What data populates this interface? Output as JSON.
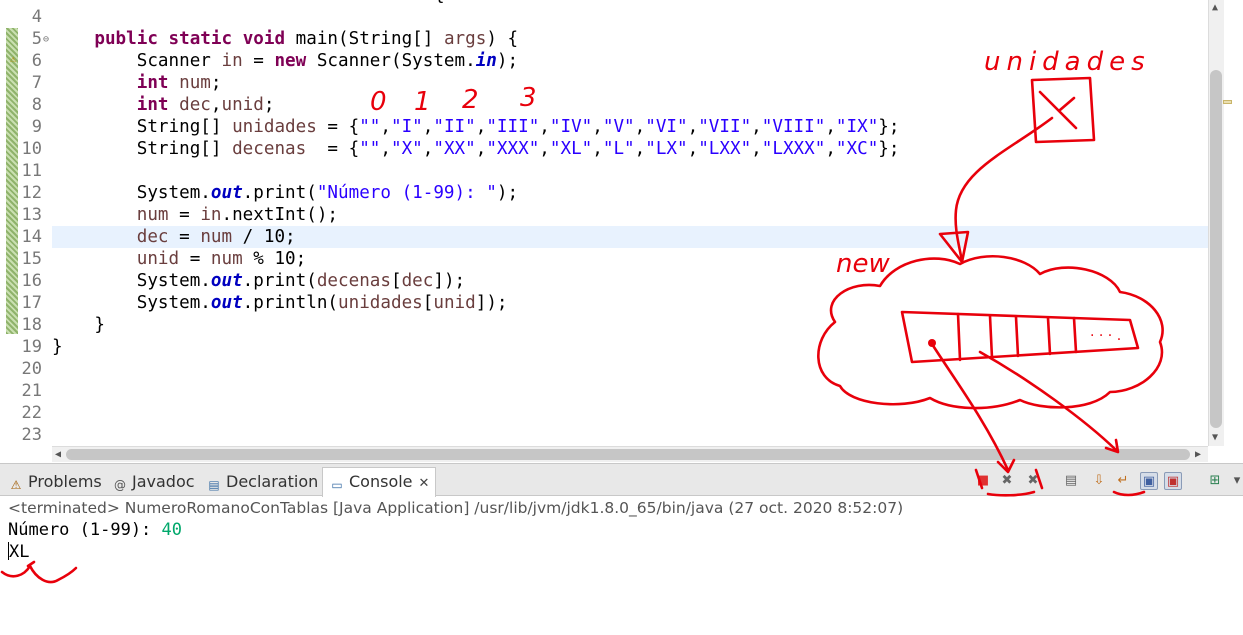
{
  "editor": {
    "line_numbers": [
      "4",
      "5",
      "6",
      "7",
      "8",
      "9",
      "10",
      "11",
      "12",
      "13",
      "14",
      "15",
      "16",
      "17",
      "18",
      "19",
      "20",
      "21",
      "22",
      "23"
    ],
    "fold_marker": "⊖",
    "top_fragment": "{",
    "current_line": "14",
    "lines": [
      {
        "n": "4",
        "tokens": []
      },
      {
        "n": "5",
        "tokens": [
          [
            "    ",
            ""
          ],
          [
            "public",
            "kw"
          ],
          [
            " ",
            ""
          ],
          [
            "static",
            "kw"
          ],
          [
            " ",
            ""
          ],
          [
            "void",
            "kw"
          ],
          [
            " main(String[] ",
            ""
          ],
          [
            "args",
            "var"
          ],
          [
            ") {",
            ""
          ]
        ]
      },
      {
        "n": "6",
        "tokens": [
          [
            "        Scanner ",
            ""
          ],
          [
            "in",
            "var"
          ],
          [
            " = ",
            ""
          ],
          [
            "new",
            "kw"
          ],
          [
            " Scanner(System.",
            ""
          ],
          [
            "in",
            "fld"
          ],
          [
            ");",
            ""
          ]
        ]
      },
      {
        "n": "7",
        "tokens": [
          [
            "        ",
            ""
          ],
          [
            "int",
            "kw"
          ],
          [
            " ",
            ""
          ],
          [
            "num",
            "var"
          ],
          [
            ";",
            ""
          ]
        ]
      },
      {
        "n": "8",
        "tokens": [
          [
            "        ",
            ""
          ],
          [
            "int",
            "kw"
          ],
          [
            " ",
            ""
          ],
          [
            "dec",
            "var"
          ],
          [
            ",",
            ""
          ],
          [
            "unid",
            "var"
          ],
          [
            ";",
            ""
          ]
        ]
      },
      {
        "n": "9",
        "tokens": [
          [
            "        String[] ",
            ""
          ],
          [
            "unidades",
            "var"
          ],
          [
            " = {",
            ""
          ],
          [
            "\"\"",
            "str"
          ],
          [
            ",",
            ""
          ],
          [
            "\"I\"",
            "str"
          ],
          [
            ",",
            ""
          ],
          [
            "\"II\"",
            "str"
          ],
          [
            ",",
            ""
          ],
          [
            "\"III\"",
            "str"
          ],
          [
            ",",
            ""
          ],
          [
            "\"IV\"",
            "str"
          ],
          [
            ",",
            ""
          ],
          [
            "\"V\"",
            "str"
          ],
          [
            ",",
            ""
          ],
          [
            "\"VI\"",
            "str"
          ],
          [
            ",",
            ""
          ],
          [
            "\"VII\"",
            "str"
          ],
          [
            ",",
            ""
          ],
          [
            "\"VIII\"",
            "str"
          ],
          [
            ",",
            ""
          ],
          [
            "\"IX\"",
            "str"
          ],
          [
            "};",
            ""
          ]
        ]
      },
      {
        "n": "10",
        "tokens": [
          [
            "        String[] ",
            ""
          ],
          [
            "decenas",
            "var"
          ],
          [
            "  = {",
            ""
          ],
          [
            "\"\"",
            "str"
          ],
          [
            ",",
            ""
          ],
          [
            "\"X\"",
            "str"
          ],
          [
            ",",
            ""
          ],
          [
            "\"XX\"",
            "str"
          ],
          [
            ",",
            ""
          ],
          [
            "\"XXX\"",
            "str"
          ],
          [
            ",",
            ""
          ],
          [
            "\"XL\"",
            "str"
          ],
          [
            ",",
            ""
          ],
          [
            "\"L\"",
            "str"
          ],
          [
            ",",
            ""
          ],
          [
            "\"LX\"",
            "str"
          ],
          [
            ",",
            ""
          ],
          [
            "\"LXX\"",
            "str"
          ],
          [
            ",",
            ""
          ],
          [
            "\"LXXX\"",
            "str"
          ],
          [
            ",",
            ""
          ],
          [
            "\"XC\"",
            "str"
          ],
          [
            "};",
            ""
          ]
        ]
      },
      {
        "n": "11",
        "tokens": []
      },
      {
        "n": "12",
        "tokens": [
          [
            "        System.",
            ""
          ],
          [
            "out",
            "fld"
          ],
          [
            ".print(",
            ""
          ],
          [
            "\"Número (1-99): \"",
            "str"
          ],
          [
            ");",
            ""
          ]
        ]
      },
      {
        "n": "13",
        "tokens": [
          [
            "        ",
            ""
          ],
          [
            "num",
            "var"
          ],
          [
            " = ",
            ""
          ],
          [
            "in",
            "var"
          ],
          [
            ".nextInt();",
            ""
          ]
        ]
      },
      {
        "n": "14",
        "tokens": [
          [
            "        ",
            ""
          ],
          [
            "dec",
            "var"
          ],
          [
            " = ",
            ""
          ],
          [
            "num",
            "var"
          ],
          [
            " / 10;",
            ""
          ]
        ]
      },
      {
        "n": "15",
        "tokens": [
          [
            "        ",
            ""
          ],
          [
            "unid",
            "var"
          ],
          [
            " = ",
            ""
          ],
          [
            "num",
            "var"
          ],
          [
            " % 10;",
            ""
          ]
        ]
      },
      {
        "n": "16",
        "tokens": [
          [
            "        System.",
            ""
          ],
          [
            "out",
            "fld"
          ],
          [
            ".print(",
            ""
          ],
          [
            "decenas",
            "var"
          ],
          [
            "[",
            ""
          ],
          [
            "dec",
            "var"
          ],
          [
            "]);",
            ""
          ]
        ]
      },
      {
        "n": "17",
        "tokens": [
          [
            "        System.",
            ""
          ],
          [
            "out",
            "fld"
          ],
          [
            ".println(",
            ""
          ],
          [
            "unidades",
            "var"
          ],
          [
            "[",
            ""
          ],
          [
            "unid",
            "var"
          ],
          [
            "]);",
            ""
          ]
        ]
      },
      {
        "n": "18",
        "tokens": [
          [
            "    }",
            ""
          ]
        ]
      },
      {
        "n": "19",
        "tokens": [
          [
            "}",
            ""
          ]
        ]
      },
      {
        "n": "20",
        "tokens": []
      },
      {
        "n": "21",
        "tokens": []
      },
      {
        "n": "22",
        "tokens": []
      },
      {
        "n": "23",
        "tokens": []
      }
    ]
  },
  "views": {
    "tabs": [
      {
        "label": "Problems",
        "icon": "problems-icon",
        "glyph": "⚠"
      },
      {
        "label": "Javadoc",
        "icon": "javadoc-icon",
        "glyph": "@"
      },
      {
        "label": "Declaration",
        "icon": "declaration-icon",
        "glyph": "▤"
      },
      {
        "label": "Console",
        "icon": "console-icon",
        "glyph": "▭",
        "active": true
      }
    ],
    "console_close_glyph": "✕",
    "toolbar": [
      {
        "name": "terminate-icon",
        "glyph": "■",
        "color": "#e03030"
      },
      {
        "name": "remove-launch-icon",
        "glyph": "✖",
        "color": "#666666"
      },
      {
        "name": "remove-all-terminated-icon",
        "glyph": "✖",
        "color": "#666666"
      },
      {
        "name": "clear-console-icon",
        "glyph": "▤",
        "color": "#666666"
      },
      {
        "name": "scroll-lock-icon",
        "glyph": "⇩",
        "color": "#c07020"
      },
      {
        "name": "word-wrap-icon",
        "glyph": "↵",
        "color": "#c07020"
      },
      {
        "name": "show-on-output-icon",
        "glyph": "▣",
        "color": "#4060a0"
      },
      {
        "name": "show-on-error-icon",
        "glyph": "▣",
        "color": "#c03030"
      },
      {
        "name": "open-console-icon",
        "glyph": "⊞",
        "color": "#2a8050"
      },
      {
        "name": "view-menu-icon",
        "glyph": "▾",
        "color": "#555555"
      }
    ],
    "console_status": "<terminated> NumeroRomanoConTablas [Java Application] /usr/lib/jvm/jdk1.8.0_65/bin/java (27 oct. 2020 8:52:07)",
    "output_prompt": "Número (1-99): ",
    "output_input": "40",
    "output_result": "XL"
  },
  "annotations": {
    "label_unidades": "unidades",
    "label_new": "new",
    "index_digits": [
      "0",
      "1",
      "2",
      "3"
    ],
    "array_dots": "· · · .",
    "color": "#e8000b"
  }
}
